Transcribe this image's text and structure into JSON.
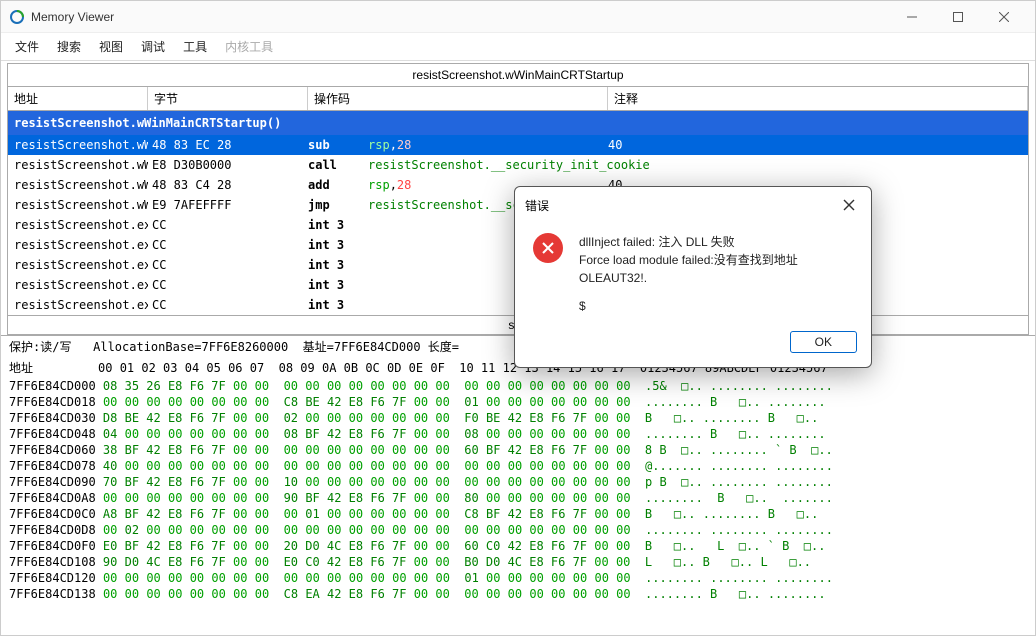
{
  "window": {
    "title": "Memory Viewer"
  },
  "menu": {
    "file": "文件",
    "search": "搜索",
    "view": "视图",
    "debug": "调试",
    "tools": "工具",
    "kernel": "内核工具"
  },
  "disasm": {
    "section_title": "resistScreenshot.wWinMainCRTStartup",
    "cols": {
      "addr": "地址",
      "bytes": "字节",
      "op": "操作码",
      "comment": "注释"
    },
    "func_header": "resistScreenshot.wWinMainCRTStartup()",
    "rows": [
      {
        "addr": "resistScreenshot.wWir",
        "bytes": "48 83 EC 28",
        "op": "sub",
        "args_html": "<span class='tk-reg'>rsp</span>,<span class='tk-num'>28</span>",
        "comment": "40",
        "sel": true
      },
      {
        "addr": "resistScreenshot.wWir",
        "bytes": "E8 D30B0000",
        "op": "call",
        "args_html": "<span class='tk-sym'>resistScreenshot.__security_init_cookie</span>",
        "comment": ""
      },
      {
        "addr": "resistScreenshot.wWir",
        "bytes": "48 83 C4 28",
        "op": "add",
        "args_html": "<span class='tk-reg'>rsp</span>,<span class='tk-num'>28</span>",
        "comment": "40"
      },
      {
        "addr": "resistScreenshot.wWir",
        "bytes": "E9 7AFEFFFF",
        "op": "jmp",
        "args_html": "<span class='tk-sym'>resistScreenshot.__scrt_c</span>",
        "comment": ""
      },
      {
        "addr": "resistScreenshot.exe+",
        "bytes": "CC",
        "op": "int 3",
        "args_html": "",
        "comment": ""
      },
      {
        "addr": "resistScreenshot.exe+",
        "bytes": "CC",
        "op": "int 3",
        "args_html": "",
        "comment": ""
      },
      {
        "addr": "resistScreenshot.exe+",
        "bytes": "CC",
        "op": "int 3",
        "args_html": "",
        "comment": ""
      },
      {
        "addr": "resistScreenshot.exe+",
        "bytes": "CC",
        "op": "int 3",
        "args_html": "",
        "comment": ""
      },
      {
        "addr": "resistScreenshot.exe+",
        "bytes": "CC",
        "op": "int 3",
        "args_html": "",
        "comment": ""
      }
    ],
    "sub_label": "sub"
  },
  "hex": {
    "header1": "保护:读/写   AllocationBase=7FF6E8260000  基址=7FF6E84CD000 长度=",
    "header2": "地址         00 01 02 03 04 05 06 07  08 09 0A 0B 0C 0D 0E 0F  10 11 12 13 14 15 16 17  01234567 89ABCDEF 01234567",
    "lines": [
      "7FF6E84CD000 08 35 26 E8 F6 7F 00 00  00 00 00 00 00 00 00 00  00 00 00 00 00 00 00 00  .5&  □.. ........ ........",
      "7FF6E84CD018 00 00 00 00 00 00 00 00  C8 BE 42 E8 F6 7F 00 00  01 00 00 00 00 00 00 00  ........ B   □.. ........",
      "7FF6E84CD030 D8 BE 42 E8 F6 7F 00 00  02 00 00 00 00 00 00 00  F0 BE 42 E8 F6 7F 00 00  B   □.. ........ B   □..",
      "7FF6E84CD048 04 00 00 00 00 00 00 00  08 BF 42 E8 F6 7F 00 00  08 00 00 00 00 00 00 00  ........ B   □.. ........",
      "7FF6E84CD060 38 BF 42 E8 F6 7F 00 00  00 00 00 00 00 00 00 00  60 BF 42 E8 F6 7F 00 00  8 B  □.. ........ ` B  □..",
      "7FF6E84CD078 40 00 00 00 00 00 00 00  00 00 00 00 00 00 00 00  00 00 00 00 00 00 00 00  @....... ........ ........",
      "7FF6E84CD090 70 BF 42 E8 F6 7F 00 00  10 00 00 00 00 00 00 00  00 00 00 00 00 00 00 00  p B  □.. ........ ........",
      "7FF6E84CD0A8 00 00 00 00 00 00 00 00  90 BF 42 E8 F6 7F 00 00  80 00 00 00 00 00 00 00  ........  B   □..  .......",
      "7FF6E84CD0C0 A8 BF 42 E8 F6 7F 00 00  00 01 00 00 00 00 00 00  C8 BF 42 E8 F6 7F 00 00  B   □.. ........ B   □..",
      "7FF6E84CD0D8 00 02 00 00 00 00 00 00  00 00 00 00 00 00 00 00  00 00 00 00 00 00 00 00  ........ ........ ........",
      "7FF6E84CD0F0 E0 BF 42 E8 F6 7F 00 00  20 D0 4C E8 F6 7F 00 00  60 C0 42 E8 F6 7F 00 00  B   □..   L  □.. ` B  □..",
      "7FF6E84CD108 90 D0 4C E8 F6 7F 00 00  E0 C0 42 E8 F6 7F 00 00  B0 D0 4C E8 F6 7F 00 00  L   □.. B   □.. L   □..",
      "7FF6E84CD120 00 00 00 00 00 00 00 00  00 00 00 00 00 00 00 00  01 00 00 00 00 00 00 00  ........ ........ ........",
      "7FF6E84CD138 00 00 00 00 00 00 00 00  C8 EA 42 E8 F6 7F 00 00  00 00 00 00 00 00 00 00  ........ B   □.. ........"
    ]
  },
  "dialog": {
    "title": "错误",
    "line1": "dllInject failed: 注入 DLL 失败",
    "line2": "Force load module failed:没有查找到地址OLEAUT32!.",
    "line3": "$",
    "ok": "OK"
  }
}
